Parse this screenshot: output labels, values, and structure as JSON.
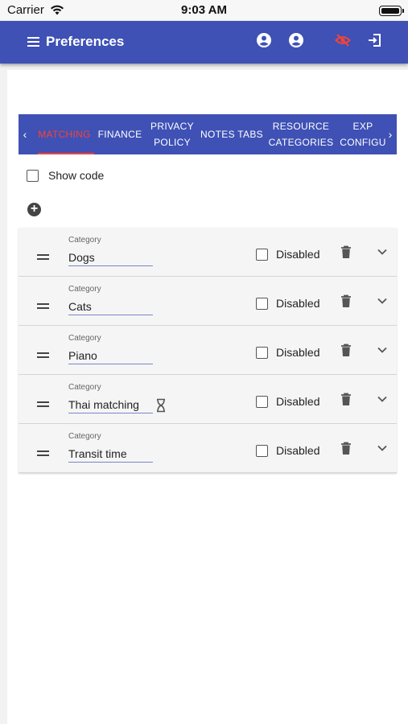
{
  "status_bar": {
    "carrier": "Carrier",
    "time": "9:03 AM"
  },
  "appbar": {
    "title": "Preferences",
    "icons": [
      "menu-icon",
      "account-circle-icon",
      "account-circle-icon",
      "eye-off-icon",
      "exit-icon"
    ],
    "accent_color": "#3f51b5",
    "alert_color": "#f44336"
  },
  "tabs": {
    "items": [
      {
        "label": "MATCHING",
        "active": true
      },
      {
        "label": "FINANCE"
      },
      {
        "label": "PRIVACY\nPOLICY"
      },
      {
        "label": "NOTES TABS"
      },
      {
        "label": "RESOURCE\nCATEGORIES"
      },
      {
        "label": "EXP\nCONFIGU"
      }
    ]
  },
  "show_code": {
    "label": "Show code",
    "checked": false
  },
  "categories": [
    {
      "field_label": "Category",
      "value": "Dogs",
      "disabled_label": "Disabled",
      "pending": false
    },
    {
      "field_label": "Category",
      "value": "Cats",
      "disabled_label": "Disabled",
      "pending": false
    },
    {
      "field_label": "Category",
      "value": "Piano",
      "disabled_label": "Disabled",
      "pending": false
    },
    {
      "field_label": "Category",
      "value": "Thai matching",
      "disabled_label": "Disabled",
      "pending": true
    },
    {
      "field_label": "Category",
      "value": "Transit time",
      "disabled_label": "Disabled",
      "pending": false
    }
  ]
}
